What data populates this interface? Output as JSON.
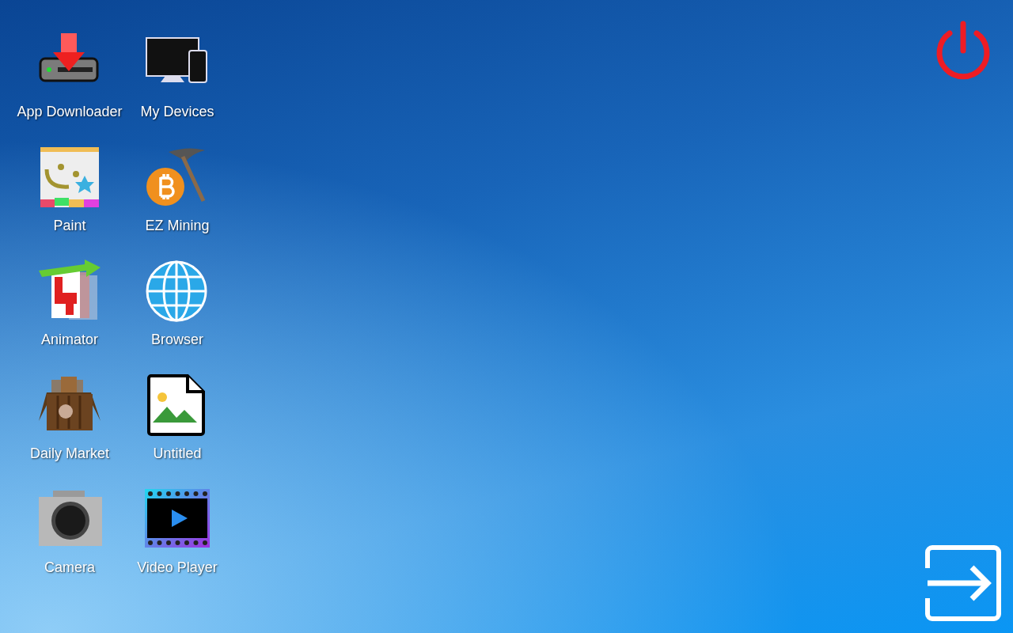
{
  "desktop_icons": [
    {
      "label": "App Downloader",
      "kind": "downloader"
    },
    {
      "label": "My Devices",
      "kind": "devices"
    },
    {
      "label": "Paint",
      "kind": "paint"
    },
    {
      "label": "EZ Mining",
      "kind": "mining"
    },
    {
      "label": "Animator",
      "kind": "animator"
    },
    {
      "label": "Browser",
      "kind": "browser"
    },
    {
      "label": "Daily Market",
      "kind": "market"
    },
    {
      "label": "Untitled",
      "kind": "image-file"
    },
    {
      "label": "Camera",
      "kind": "camera"
    },
    {
      "label": "Video Player",
      "kind": "video"
    }
  ]
}
